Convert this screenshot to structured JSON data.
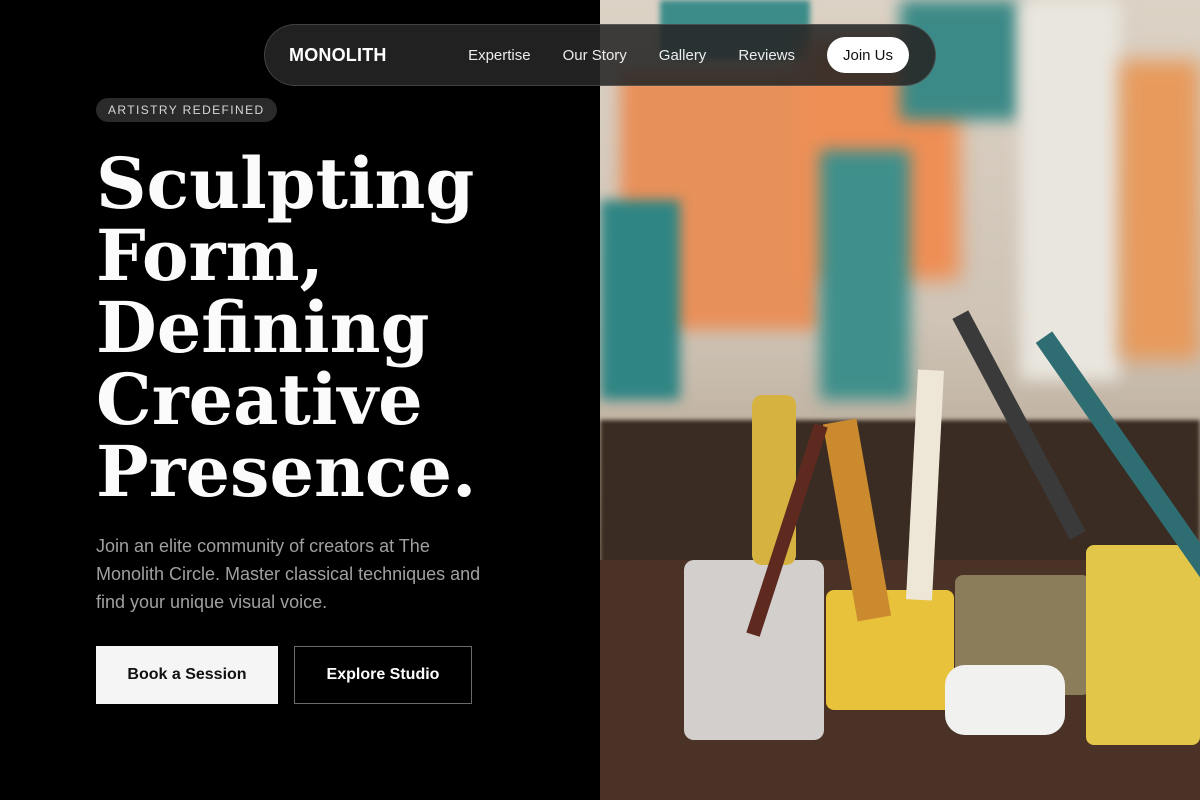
{
  "nav": {
    "brand": "MONOLITH",
    "links": [
      "Expertise",
      "Our Story",
      "Gallery",
      "Reviews"
    ],
    "cta": "Join Us"
  },
  "hero": {
    "badge": "ARTISTRY REDEFINED",
    "headline_lines": [
      "Sculpting",
      "Form,",
      "Defining",
      "Creative",
      "Presence."
    ],
    "subtitle": "Join an elite community of creators at The Monolith Circle. Master classical techniques and find your unique visual voice.",
    "buttons": {
      "primary": "Book a Session",
      "secondary": "Explore Studio"
    }
  },
  "image": {
    "icon": "art-studio-photo"
  },
  "colors": {
    "background": "#000000",
    "nav_bg": "#262626",
    "text": "#f4f4f4"
  }
}
